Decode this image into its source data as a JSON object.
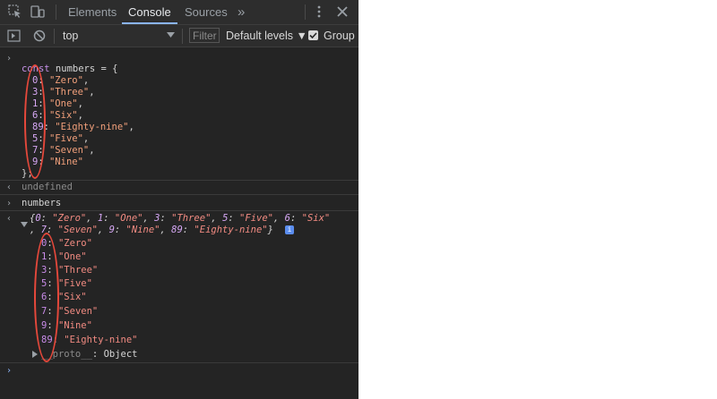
{
  "tabs": [
    {
      "label": "Elements"
    },
    {
      "label": "Console"
    },
    {
      "label": "Sources"
    }
  ],
  "overflow_label": "»",
  "context_label": "top",
  "filter_placeholder": "Filter",
  "levels_label": "Default levels ▼",
  "group_label": "Group",
  "code": {
    "head": {
      "kw": "const",
      "rest": " numbers = {"
    },
    "entries": [
      {
        "key": "0",
        "value": "\"Zero\"",
        "end": ","
      },
      {
        "key": "3",
        "value": "\"Three\"",
        "end": ","
      },
      {
        "key": "1",
        "value": "\"One\"",
        "end": ","
      },
      {
        "key": "6",
        "value": "\"Six\"",
        "end": ","
      },
      {
        "key": "89",
        "value": "\"Eighty-nine\"",
        "end": ","
      },
      {
        "key": "5",
        "value": "\"Five\"",
        "end": ","
      },
      {
        "key": "7",
        "value": "\"Seven\"",
        "end": ","
      },
      {
        "key": "9",
        "value": "\"Nine\"",
        "end": ""
      }
    ],
    "close": "};"
  },
  "undefined_text": "undefined",
  "input_text": "numbers",
  "summary": {
    "line1": [
      {
        "t": "{"
      },
      {
        "t": "0",
        "c": "k"
      },
      {
        "t": ": "
      },
      {
        "t": "\"Zero\"",
        "c": "v"
      },
      {
        "t": ", "
      },
      {
        "t": "1",
        "c": "k"
      },
      {
        "t": ": "
      },
      {
        "t": "\"One\"",
        "c": "v"
      },
      {
        "t": ", "
      },
      {
        "t": "3",
        "c": "k"
      },
      {
        "t": ": "
      },
      {
        "t": "\"Three\"",
        "c": "v"
      },
      {
        "t": ", "
      },
      {
        "t": "5",
        "c": "k"
      },
      {
        "t": ": "
      },
      {
        "t": "\"Five\"",
        "c": "v"
      },
      {
        "t": ", "
      },
      {
        "t": "6",
        "c": "k"
      },
      {
        "t": ": "
      },
      {
        "t": "\"Six\"",
        "c": "v"
      }
    ],
    "line2": [
      {
        "t": ", "
      },
      {
        "t": "7",
        "c": "k"
      },
      {
        "t": ": "
      },
      {
        "t": "\"Seven\"",
        "c": "v"
      },
      {
        "t": ", "
      },
      {
        "t": "9",
        "c": "k"
      },
      {
        "t": ": "
      },
      {
        "t": "\"Nine\"",
        "c": "v"
      },
      {
        "t": ", "
      },
      {
        "t": "89",
        "c": "k"
      },
      {
        "t": ": "
      },
      {
        "t": "\"Eighty-nine\"",
        "c": "v"
      },
      {
        "t": "}"
      }
    ]
  },
  "tree": [
    {
      "key": "0",
      "value": "\"Zero\""
    },
    {
      "key": "1",
      "value": "\"One\""
    },
    {
      "key": "3",
      "value": "\"Three\""
    },
    {
      "key": "5",
      "value": "\"Five\""
    },
    {
      "key": "6",
      "value": "\"Six\""
    },
    {
      "key": "7",
      "value": "\"Seven\""
    },
    {
      "key": "9",
      "value": "\"Nine\""
    },
    {
      "key": "89",
      "value": "\"Eighty-nine\""
    }
  ],
  "proto": {
    "key": "__proto__",
    "value": "Object"
  },
  "colors": {
    "accent_ring": "#e5483b",
    "string": "#f2a07b",
    "keys": "#c792ea",
    "background": "#242424"
  }
}
